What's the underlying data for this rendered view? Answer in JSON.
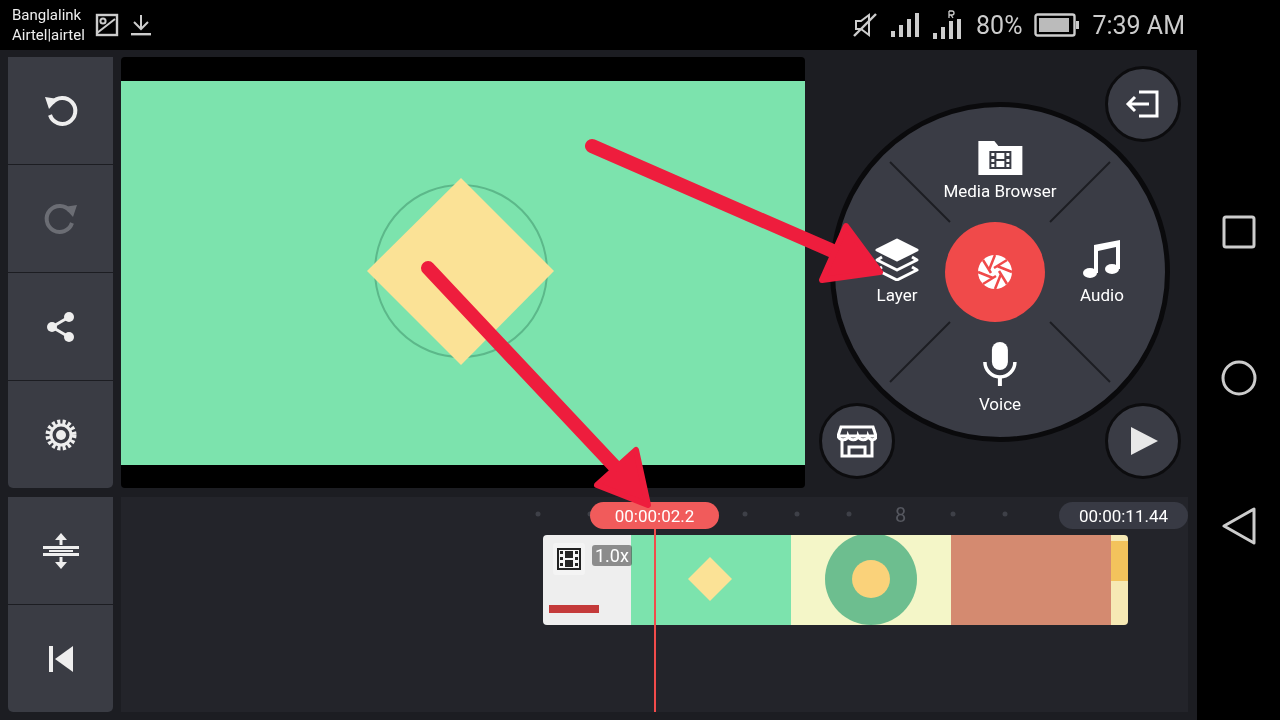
{
  "status_bar": {
    "carriers": [
      "Banglalink",
      "Airtel|airtel"
    ],
    "battery": "80%",
    "time": "7:39 AM"
  },
  "tools": [
    {
      "kind": "undo",
      "disabled": false
    },
    {
      "kind": "redo",
      "disabled": true
    },
    {
      "kind": "share",
      "disabled": false
    },
    {
      "kind": "settings",
      "disabled": false
    }
  ],
  "timeline_tools": [
    {
      "kind": "adjust"
    },
    {
      "kind": "rewind"
    }
  ],
  "radial_menu": [
    {
      "kind": "media",
      "label": "Media Browser"
    },
    {
      "kind": "layer",
      "label": "Layer"
    },
    {
      "kind": "audio",
      "label": "Audio"
    },
    {
      "kind": "voice",
      "label": "Voice"
    }
  ],
  "timeline": {
    "current_time": "00:00:02.2",
    "ruler_label": "8",
    "total_time": "00:00:11.44",
    "clip_speed": "1.0x"
  }
}
